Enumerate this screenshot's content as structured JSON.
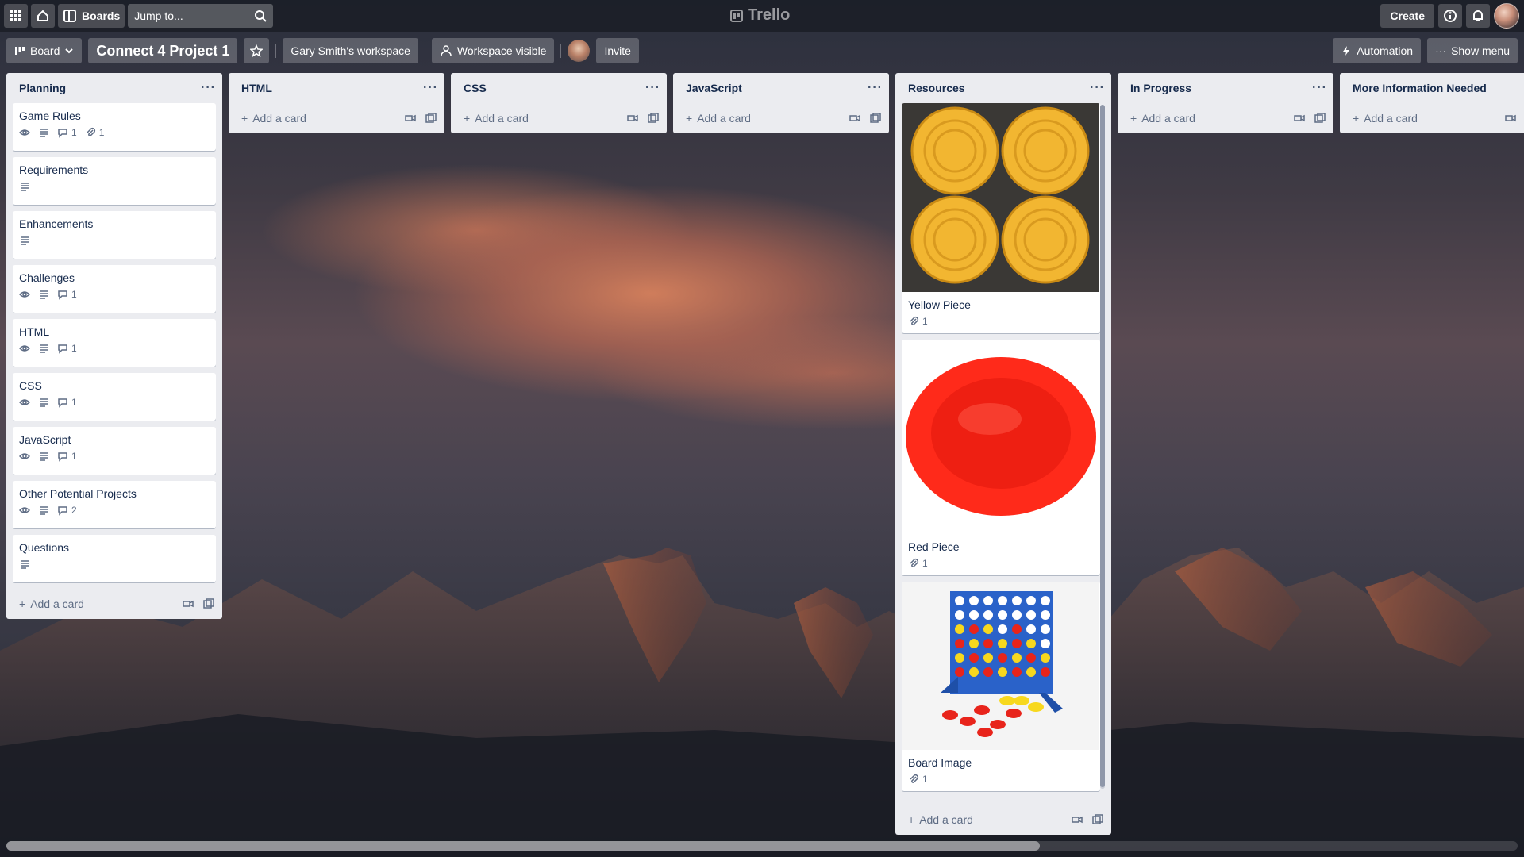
{
  "topbar": {
    "boards_label": "Boards",
    "jump_placeholder": "Jump to...",
    "logo_text": "Trello",
    "create_label": "Create"
  },
  "board": {
    "view_label": "Board",
    "title": "Connect 4 Project 1",
    "workspace_label": "Gary Smith's workspace",
    "visibility_label": "Workspace visible",
    "invite_label": "Invite",
    "automation_label": "Automation",
    "show_menu_label": "Show menu"
  },
  "add_card_label": "Add a card",
  "lists": [
    {
      "title": "Planning",
      "cards": [
        {
          "title": "Game Rules",
          "comments": "1",
          "attachments": "1"
        },
        {
          "title": "Requirements"
        },
        {
          "title": "Enhancements"
        },
        {
          "title": "Challenges",
          "comments": "1"
        },
        {
          "title": "HTML",
          "comments": "1"
        },
        {
          "title": "CSS",
          "comments": "1"
        },
        {
          "title": "JavaScript",
          "comments": "1"
        },
        {
          "title": "Other Potential Projects",
          "comments": "2"
        },
        {
          "title": "Questions"
        }
      ]
    },
    {
      "title": "HTML",
      "cards": []
    },
    {
      "title": "CSS",
      "cards": []
    },
    {
      "title": "JavaScript",
      "cards": []
    },
    {
      "title": "Resources",
      "cards": [
        {
          "title": "Yellow Piece",
          "attachments": "1"
        },
        {
          "title": "Red Piece",
          "attachments": "1"
        },
        {
          "title": "Board Image",
          "attachments": "1"
        }
      ]
    },
    {
      "title": "In Progress",
      "cards": []
    },
    {
      "title": "More Information Needed",
      "cards": []
    }
  ],
  "colors": {
    "list_bg": "#ebecf0",
    "card_bg": "#ffffff",
    "text": "#172b4d",
    "muted": "#5e6c84",
    "yellow_piece": "#f2b631",
    "red_piece": "#ff2a1a",
    "board_blue": "#2a62c9"
  }
}
